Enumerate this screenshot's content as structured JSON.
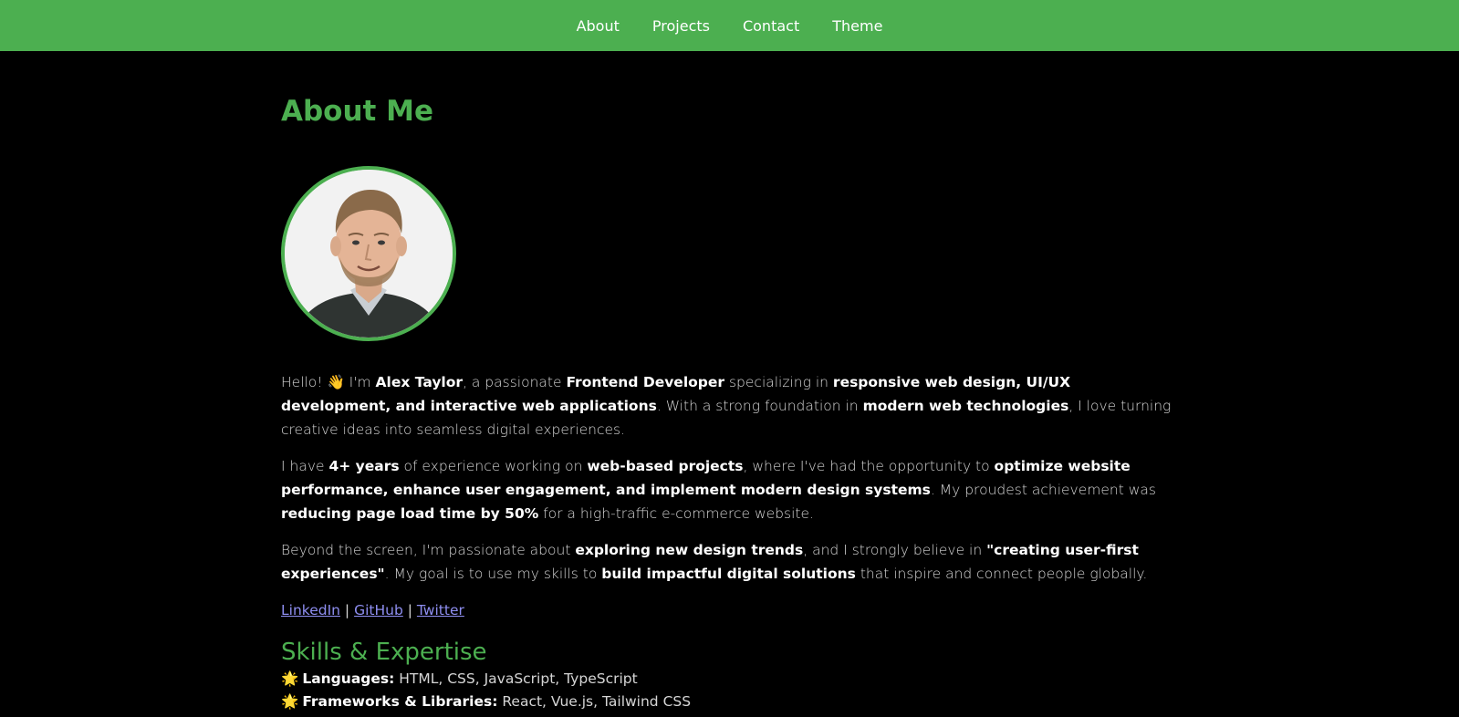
{
  "nav": {
    "items": [
      "About",
      "Projects",
      "Contact",
      "Theme"
    ]
  },
  "about": {
    "title": "About Me",
    "para1": {
      "t1": "Hello! ",
      "wave": "👋",
      "t2": " I'm ",
      "b1": "Alex Taylor",
      "t3": ", a passionate ",
      "b2": "Frontend Developer",
      "t4": " specializing in ",
      "b3": "responsive web design, UI/UX development, and interactive web applications",
      "t5": ". With a strong foundation in ",
      "b4": "modern web technologies",
      "t6": ", I love turning creative ideas into seamless digital experiences."
    },
    "para2": {
      "t1": "I have ",
      "b1": "4+ years",
      "t2": " of experience working on ",
      "b2": "web-based projects",
      "t3": ", where I've had the opportunity to ",
      "b3": "optimize website performance, enhance user engagement, and implement modern design systems",
      "t4": ". My proudest achievement was ",
      "b4": "reducing page load time by 50%",
      "t5": " for a high-traffic e-commerce website."
    },
    "para3": {
      "t1": "Beyond the screen, I'm passionate about ",
      "b1": "exploring new design trends",
      "t2": ", and I strongly believe in ",
      "b2": "\"creating user-first experiences\"",
      "t3": ". My goal is to use my skills to ",
      "b3": "build impactful digital solutions",
      "t4": " that inspire and connect people globally."
    },
    "links": [
      "LinkedIn",
      "GitHub",
      "Twitter"
    ],
    "separator": "|"
  },
  "skills": {
    "title": "Skills & Expertise",
    "items": [
      {
        "icon": "🌟",
        "label": "Languages:",
        "value": " HTML, CSS, JavaScript, TypeScript"
      },
      {
        "icon": "🌟",
        "label": "Frameworks & Libraries:",
        "value": " React, Vue.js, Tailwind CSS"
      }
    ]
  },
  "colors": {
    "accent": "#4caf50",
    "background": "#000000",
    "link": "#8e8ef0"
  }
}
